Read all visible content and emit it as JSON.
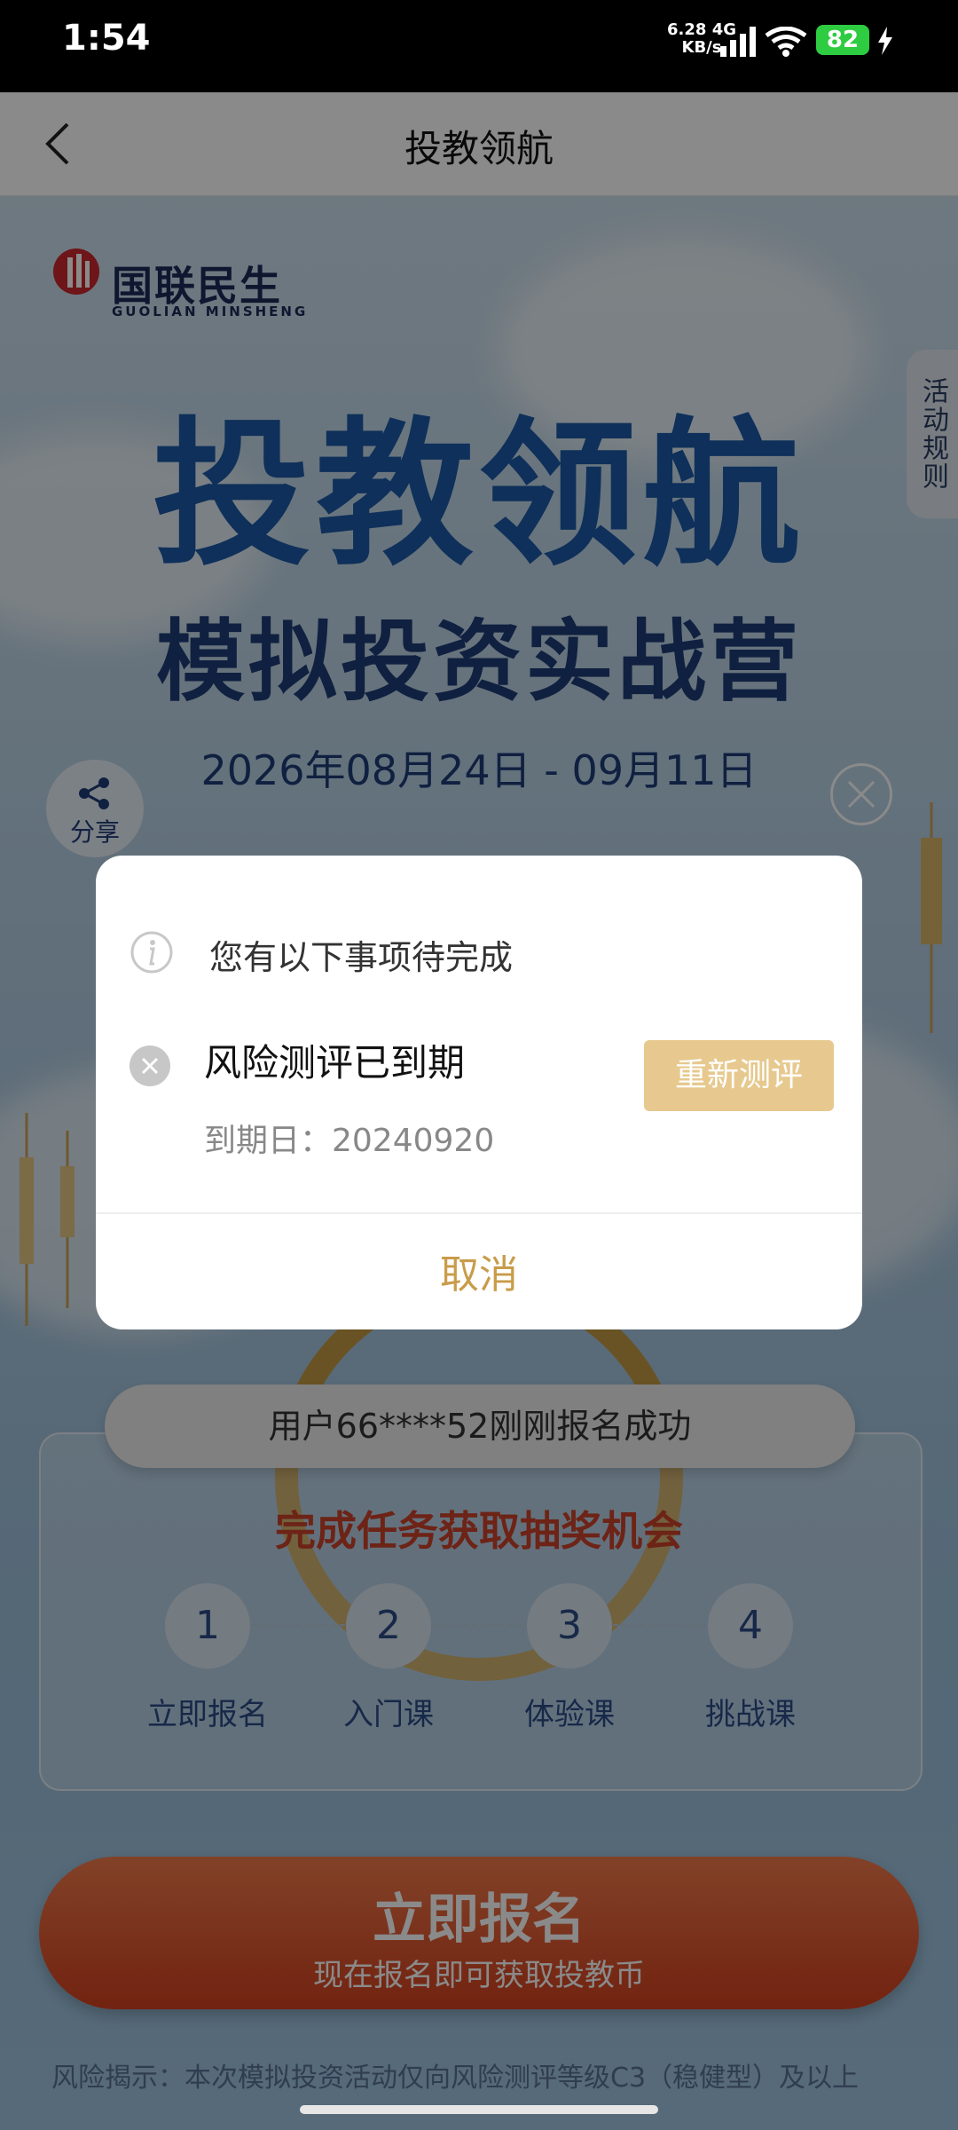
{
  "status_bar": {
    "time": "1:54",
    "net_speed": "6.28",
    "net_speed_unit": "KB/s",
    "network": "4G",
    "battery": "82"
  },
  "navbar": {
    "title": "投教领航"
  },
  "logo": {
    "cn": "国联民生",
    "en": "GUOLIAN MINSHENG"
  },
  "rules_tab": "活动规则",
  "hero": {
    "title": "投教领航",
    "subtitle": "模拟投资实战营",
    "date_range": "2026年08月24日 - 09月11日"
  },
  "share": {
    "label": "分享"
  },
  "ticker": "用户66****52刚刚报名成功",
  "tasks": {
    "title": "完成任务获取抽奖机会",
    "steps": [
      {
        "num": "1",
        "label": "立即报名"
      },
      {
        "num": "2",
        "label": "入门课"
      },
      {
        "num": "3",
        "label": "体验课"
      },
      {
        "num": "4",
        "label": "挑战课"
      }
    ]
  },
  "cta": {
    "main": "立即报名",
    "sub": "现在报名即可获取投教币"
  },
  "risk_notice": "风险揭示：本次模拟投资活动仅向风险测评等级C3（稳健型）及以上",
  "dialog": {
    "header": "您有以下事项待完成",
    "item_title": "风险测评已到期",
    "item_sub": "到期日：20240920",
    "action": "重新测评",
    "cancel": "取消"
  },
  "colors": {
    "accent_gold": "#e7c98f",
    "cancel_text": "#c89c4a",
    "cta_red": "#d3411f"
  }
}
